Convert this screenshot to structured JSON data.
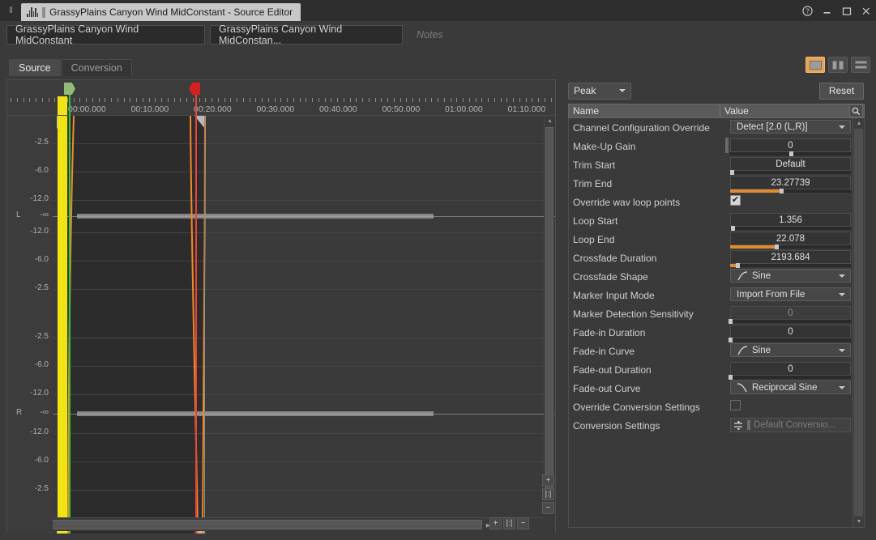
{
  "window": {
    "tab_title": "GrassyPlains Canyon Wind MidConstant - Source Editor",
    "icon": "waveform-icon",
    "grip": "⋮⋮",
    "controls": {
      "help": "help-icon",
      "minimize": "minimize-icon",
      "maximize": "maximize-icon",
      "close": "close-icon"
    }
  },
  "name_row": {
    "object_name": "GrassyPlains Canyon Wind MidConstant",
    "source_name": "GrassyPlains Canyon Wind MidConstan...",
    "notes_placeholder": "Notes"
  },
  "tabs": [
    {
      "label": "Source",
      "active": true
    },
    {
      "label": "Conversion",
      "active": false
    }
  ],
  "view_modes": [
    {
      "name": "single-pane",
      "selected": true
    },
    {
      "name": "vertical-split",
      "selected": false
    },
    {
      "name": "horizontal-split",
      "selected": false
    }
  ],
  "waveform": {
    "time_labels": [
      "00:00.000",
      "00:10.000",
      "00:20.000",
      "00:30.000",
      "00:40.000",
      "00:50.000",
      "01:00.000",
      "01:10.000"
    ],
    "channels": [
      {
        "label": "L",
        "db_ticks": [
          "-2.5",
          "-6.0",
          "-12.0",
          "-∞",
          "-12.0",
          "-6.0",
          "-2.5"
        ]
      },
      {
        "label": "R",
        "db_ticks": [
          "-2.5",
          "-6.0",
          "-12.0",
          "-∞",
          "-12.0",
          "-6.0",
          "-2.5"
        ]
      }
    ],
    "markers": {
      "loop_start_flag": "loop-start-flag",
      "loop_end_flag": "loop-end-flag"
    },
    "zoom_in": "+",
    "zoom_fit": "|:|",
    "zoom_out": "−",
    "scroll_left": "◀",
    "scroll_right": "▶",
    "scroll_up": "▲",
    "scroll_down": "▼"
  },
  "properties": {
    "view_mode": "Peak",
    "reset_label": "Reset",
    "columns": {
      "name": "Name",
      "value": "Value"
    },
    "search_icon": "search-icon",
    "rows": [
      {
        "name": "Channel Configuration Override",
        "value": "Detect [2.0 (L,R)]",
        "type": "combo"
      },
      {
        "name": "Make-Up Gain",
        "value": "0",
        "type": "slider",
        "fill": 0,
        "knob": 50,
        "nub": true
      },
      {
        "name": "Trim Start",
        "value": "Default",
        "type": "slider",
        "fill": 0,
        "knob": 1
      },
      {
        "name": "Trim End",
        "value": "23.27739",
        "type": "slider",
        "fill": 42,
        "knob": 42
      },
      {
        "name": "Override wav loop points",
        "value": "checked",
        "type": "checkbox"
      },
      {
        "name": "Loop Start",
        "value": "1.356",
        "type": "slider",
        "fill": 0,
        "knob": 2
      },
      {
        "name": "Loop End",
        "value": "22.078",
        "type": "slider",
        "fill": 38,
        "knob": 38
      },
      {
        "name": "Crossfade Duration",
        "value": "2193.684",
        "type": "slider",
        "fill": 6,
        "knob": 6
      },
      {
        "name": "Crossfade Shape",
        "value": "Sine",
        "type": "combo",
        "icon": "curve-sine-icon"
      },
      {
        "name": "Marker Input Mode",
        "value": "Import From File",
        "type": "combo"
      },
      {
        "name": "Marker Detection Sensitivity",
        "value": "0",
        "type": "slider",
        "disabled": true,
        "fill": 0,
        "knob": 0
      },
      {
        "name": "Fade-in Duration",
        "value": "0",
        "type": "slider",
        "fill": 0,
        "knob": 0
      },
      {
        "name": "Fade-in Curve",
        "value": "Sine",
        "type": "combo",
        "icon": "curve-sine-icon"
      },
      {
        "name": "Fade-out Duration",
        "value": "0",
        "type": "slider",
        "fill": 0,
        "knob": 0
      },
      {
        "name": "Fade-out Curve",
        "value": "Reciprocal Sine",
        "type": "combo",
        "icon": "curve-recip-sine-icon"
      },
      {
        "name": "Override Conversion Settings",
        "value": "unchecked",
        "type": "checkbox"
      },
      {
        "name": "Conversion Settings",
        "value": "Default Conversio...",
        "type": "button"
      }
    ]
  },
  "colors": {
    "accent_orange": "#e08a33",
    "loop_start_green": "#35c635",
    "loop_end_red": "#e8443c",
    "trim_yellow": "#f2e414",
    "selected_tab": "#e8a355"
  }
}
